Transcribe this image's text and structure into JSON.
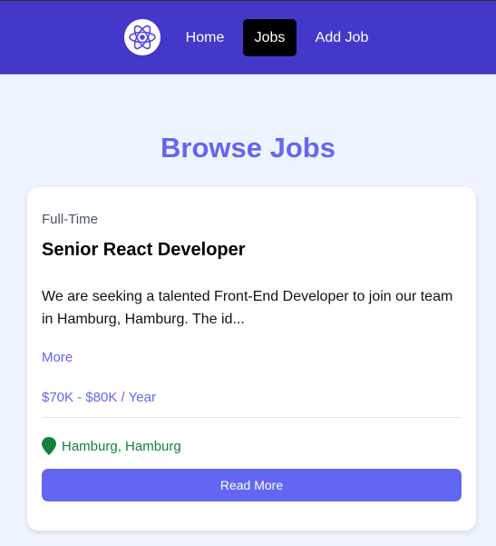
{
  "navbar": {
    "logo_icon": "react-atom-icon",
    "links": [
      {
        "label": "Home",
        "active": false
      },
      {
        "label": "Jobs",
        "active": true
      },
      {
        "label": "Add Job",
        "active": false
      }
    ],
    "background_color": "#4338ca",
    "active_color": "#000000"
  },
  "main": {
    "title": "Browse Jobs",
    "jobs": [
      {
        "type": "Full-Time",
        "title": "Senior React Developer",
        "description": "We are seeking a talented Front-End Developer to join our team in Hamburg, Hamburg. The id...",
        "more_label": "More",
        "salary": "$70K - $80K / Year",
        "location_icon": "map-marker-icon",
        "location": "Hamburg, Hamburg",
        "button_label": "Read More"
      }
    ]
  },
  "colors": {
    "accent": "#6366f1",
    "location": "#15803d",
    "page_background": "#eef4ff"
  }
}
